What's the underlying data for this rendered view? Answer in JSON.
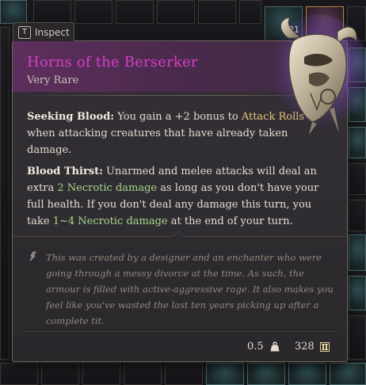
{
  "inspect_tab": {
    "key": "T",
    "label": "Inspect"
  },
  "item": {
    "name": "Horns of the Berserker",
    "rarity": "Very Rare",
    "icon": "horned-helmet-icon"
  },
  "abilities": [
    {
      "name": "Seeking Blood:",
      "text_1": " You gain a +2 bonus to ",
      "highlight_1": "Attack Rolls",
      "text_2": " when attacking creatures that have already taken damage."
    },
    {
      "name": "Blood Thirst:",
      "text_1": " Unarmed and melee attacks will deal an extra ",
      "highlight_1": "2 Necrotic damage",
      "text_2": " as long as you don't have your full health. If you don't deal any damage this turn, you take ",
      "highlight_2": "1~4 Necrotic damage",
      "text_3": " at the end of your turn."
    }
  ],
  "lore": {
    "icon": "quill-icon",
    "text": "This was created by a designer and an enchanter who were going through a messy divorce at the time. As such, the armour is filled with active-aggressive rage. It also makes you feel like you've wasted the last ten years picking up after a complete tit."
  },
  "footer": {
    "weight": "0.5",
    "weight_icon": "weight-icon",
    "value": "328",
    "value_icon": "gold-coin-icon"
  },
  "inventory": {
    "stack_count": "21"
  },
  "colors": {
    "rarity_very_rare": "#d53fc4",
    "highlight_gold": "#e3c27a",
    "highlight_green": "#a8d78c"
  }
}
